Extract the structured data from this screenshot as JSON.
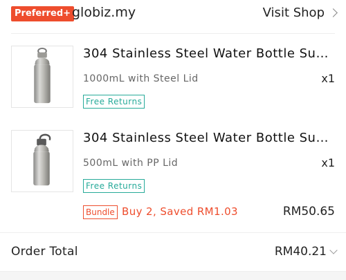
{
  "shop": {
    "badge": "Preferred+",
    "name": "globiz.my",
    "visit_label": "Visit Shop"
  },
  "items": [
    {
      "title": "304 Stainless Steel Water Bottle Supe...",
      "variant": "1000mL with Steel Lid",
      "qty": "x1",
      "free_returns": "Free Returns"
    },
    {
      "title": "304 Stainless Steel Water Bottle Supe...",
      "variant": "500mL with PP Lid",
      "qty": "x1",
      "free_returns": "Free Returns"
    }
  ],
  "bundle": {
    "tag": "Bundle",
    "text": "Buy 2, Saved RM1.03",
    "price": "RM50.65"
  },
  "order_total": {
    "label": "Order Total",
    "value": "RM40.21"
  },
  "colors": {
    "accent": "#ee4d2d",
    "teal": "#26aa99"
  }
}
